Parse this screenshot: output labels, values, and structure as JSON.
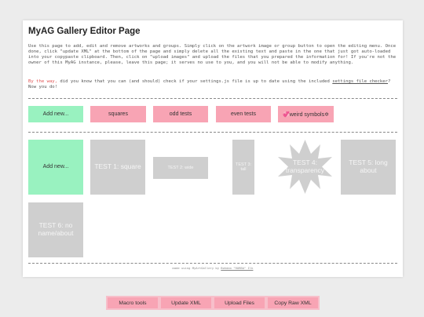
{
  "page": {
    "title": "MyAG Gallery Editor Page",
    "intro": "Use this page to add, edit and remove artworks and groups. Simply click on the artwork image or group button to open the editing menu. Once done, click \"update XML\" at the bottom of the page and simply delete all the existing text and paste in the one that just got auto-loaded into your copypaste clipboard. Then, click on \"upload images\" and upload the files that you prepared the information for! If you're not the owner of this MyAG instance, please, leave this page; it serves no use to you, and you will not be able to modify anything.",
    "tip_prefix": "By the way,",
    "tip_mid": " did you know that you can (and should) check if your settings.js file is up to date using the included ",
    "tip_link": "settings file checker",
    "tip_suffix": "? Now you do!"
  },
  "groups": [
    {
      "label": "Add new..."
    },
    {
      "label": "squares"
    },
    {
      "label": "odd tests"
    },
    {
      "label": "even tests"
    },
    {
      "label": "💞weird symbols✡"
    }
  ],
  "artworks": [
    {
      "label": "Add new..."
    },
    {
      "label": "TEST 1: square"
    },
    {
      "label": "TEST 2: wide"
    },
    {
      "label": "TEST 3: tall"
    },
    {
      "label": "TEST 4: transparency"
    },
    {
      "label": "TEST 5: long about"
    },
    {
      "label": "TEST 6: no name/about"
    }
  ],
  "footer": {
    "credit_prefix": "made using MyArtGallery by ",
    "credit_link": "Bohdan \"RORBA\" Ilk"
  },
  "toolbar": {
    "macro_tools": "Macro tools",
    "update_xml": "Update XML",
    "upload_files": "Upload Files",
    "copy_raw_xml": "Copy Raw XML"
  },
  "colors": {
    "accent_pink": "#f8a4b4",
    "accent_green": "#99f2c0",
    "placeholder_gray": "#cfcfcf",
    "link_red": "#e05555"
  }
}
